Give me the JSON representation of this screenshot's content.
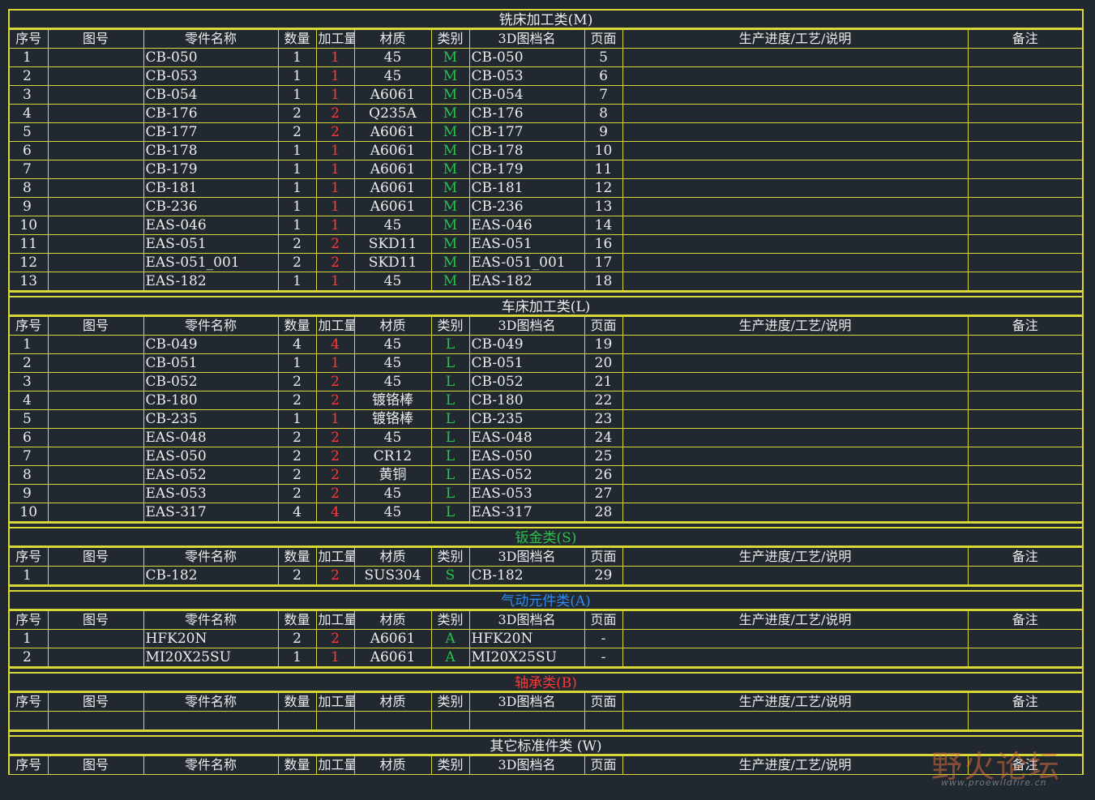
{
  "headers": [
    "序号",
    "图号",
    "零件名称",
    "数量",
    "加工量",
    "材质",
    "类别",
    "3D图档名",
    "页面",
    "生产进度/工艺/说明",
    "备注"
  ],
  "sections": [
    {
      "title": "铣床加工类(M)",
      "color": "#ececec",
      "code_color": "#29c24a",
      "rows": [
        [
          "1",
          "",
          "CB-050",
          "1",
          "1",
          "45",
          "M",
          "CB-050",
          "5",
          "",
          ""
        ],
        [
          "2",
          "",
          "CB-053",
          "1",
          "1",
          "45",
          "M",
          "CB-053",
          "6",
          "",
          ""
        ],
        [
          "3",
          "",
          "CB-054",
          "1",
          "1",
          "A6061",
          "M",
          "CB-054",
          "7",
          "",
          ""
        ],
        [
          "4",
          "",
          "CB-176",
          "2",
          "2",
          "Q235A",
          "M",
          "CB-176",
          "8",
          "",
          ""
        ],
        [
          "5",
          "",
          "CB-177",
          "2",
          "2",
          "A6061",
          "M",
          "CB-177",
          "9",
          "",
          ""
        ],
        [
          "6",
          "",
          "CB-178",
          "1",
          "1",
          "A6061",
          "M",
          "CB-178",
          "10",
          "",
          ""
        ],
        [
          "7",
          "",
          "CB-179",
          "1",
          "1",
          "A6061",
          "M",
          "CB-179",
          "11",
          "",
          ""
        ],
        [
          "8",
          "",
          "CB-181",
          "1",
          "1",
          "A6061",
          "M",
          "CB-181",
          "12",
          "",
          ""
        ],
        [
          "9",
          "",
          "CB-236",
          "1",
          "1",
          "A6061",
          "M",
          "CB-236",
          "13",
          "",
          ""
        ],
        [
          "10",
          "",
          "EAS-046",
          "1",
          "1",
          "45",
          "M",
          "EAS-046",
          "14",
          "",
          ""
        ],
        [
          "11",
          "",
          "EAS-051",
          "2",
          "2",
          "SKD11",
          "M",
          "EAS-051",
          "16",
          "",
          ""
        ],
        [
          "12",
          "",
          "EAS-051_001",
          "2",
          "2",
          "SKD11",
          "M",
          "EAS-051_001",
          "17",
          "",
          ""
        ],
        [
          "13",
          "",
          "EAS-182",
          "1",
          "1",
          "45",
          "M",
          "EAS-182",
          "18",
          "",
          ""
        ]
      ]
    },
    {
      "title": "车床加工类(L)",
      "color": "#ececec",
      "code_color": "#29c24a",
      "rows": [
        [
          "1",
          "",
          "CB-049",
          "4",
          "4",
          "45",
          "L",
          "CB-049",
          "19",
          "",
          ""
        ],
        [
          "2",
          "",
          "CB-051",
          "1",
          "1",
          "45",
          "L",
          "CB-051",
          "20",
          "",
          ""
        ],
        [
          "3",
          "",
          "CB-052",
          "2",
          "2",
          "45",
          "L",
          "CB-052",
          "21",
          "",
          ""
        ],
        [
          "4",
          "",
          "CB-180",
          "2",
          "2",
          "镀铬棒",
          "L",
          "CB-180",
          "22",
          "",
          ""
        ],
        [
          "5",
          "",
          "CB-235",
          "1",
          "1",
          "镀铬棒",
          "L",
          "CB-235",
          "23",
          "",
          ""
        ],
        [
          "6",
          "",
          "EAS-048",
          "2",
          "2",
          "45",
          "L",
          "EAS-048",
          "24",
          "",
          ""
        ],
        [
          "7",
          "",
          "EAS-050",
          "2",
          "2",
          "CR12",
          "L",
          "EAS-050",
          "25",
          "",
          ""
        ],
        [
          "8",
          "",
          "EAS-052",
          "2",
          "2",
          "黄铜",
          "L",
          "EAS-052",
          "26",
          "",
          ""
        ],
        [
          "9",
          "",
          "EAS-053",
          "2",
          "2",
          "45",
          "L",
          "EAS-053",
          "27",
          "",
          ""
        ],
        [
          "10",
          "",
          "EAS-317",
          "4",
          "4",
          "45",
          "L",
          "EAS-317",
          "28",
          "",
          ""
        ]
      ]
    },
    {
      "title": "钣金类(S)",
      "color": "#29c24a",
      "code_color": "#29c24a",
      "rows": [
        [
          "1",
          "",
          "CB-182",
          "2",
          "2",
          "SUS304",
          "S",
          "CB-182",
          "29",
          "",
          ""
        ]
      ]
    },
    {
      "title": "气动元件类(A)",
      "color": "#2f8cf0",
      "code_color": "#29c24a",
      "rows": [
        [
          "1",
          "",
          "HFK20N",
          "2",
          "2",
          "A6061",
          "A",
          "HFK20N",
          "-",
          "",
          ""
        ],
        [
          "2",
          "",
          "MI20X25SU",
          "1",
          "1",
          "A6061",
          "A",
          "MI20X25SU",
          "-",
          "",
          ""
        ]
      ]
    },
    {
      "title": "轴承类(B)",
      "color": "#ff3838",
      "code_color": "#29c24a",
      "rows": [
        [
          "",
          "",
          "",
          "",
          "",
          "",
          "",
          "",
          "",
          "",
          ""
        ]
      ]
    },
    {
      "title": "其它标准件类 (W)",
      "color": "#ececec",
      "code_color": "#29c24a",
      "rows": []
    }
  ],
  "watermark": {
    "text": "野火论坛",
    "url": "www.proewildfire.cn"
  }
}
